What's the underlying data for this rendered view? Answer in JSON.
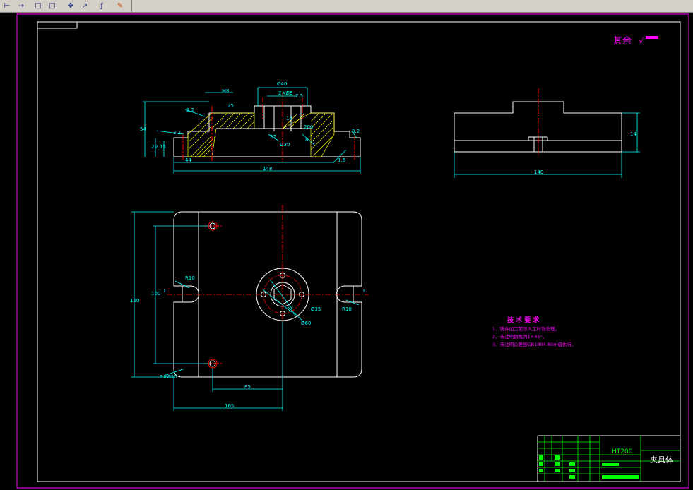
{
  "toolbar": {
    "buttons": [
      {
        "name": "dimension-linear-icon",
        "glyph": "⊢"
      },
      {
        "name": "dimension-continue-icon",
        "glyph": "⇢"
      },
      {
        "name": "rectangle-icon",
        "glyph": "□"
      },
      {
        "name": "square-icon",
        "glyph": "□"
      },
      {
        "name": "move-cross-icon",
        "glyph": "✥"
      },
      {
        "name": "leader-icon",
        "glyph": "↗"
      },
      {
        "name": "tolerance-icon",
        "glyph": "ƒ"
      },
      {
        "name": "eraser-icon",
        "glyph": "✎"
      }
    ]
  },
  "drawing": {
    "roughness_label": "其余",
    "roughness_symbol": "√",
    "front_view_dims": [
      "Ø40",
      "M8",
      "2×Ø8",
      "7.5",
      "25",
      "54",
      "27",
      "Ø30",
      "20",
      "15",
      "3.2",
      "14",
      "8",
      "1.6",
      "3.2",
      "3.2",
      "200",
      "148",
      "44"
    ],
    "side_view_dims": [
      "14",
      "140"
    ],
    "top_view_dims": [
      "150",
      "100",
      "R10",
      "R10",
      "2×Ø10",
      "Ø35",
      "Ø60",
      "85",
      "165",
      "C",
      "C"
    ],
    "tech_req_title": "技 术 要 求",
    "tech_req_items": [
      "1、铸件加工前须人工时效处理。",
      "2、未注明倒角为1×45°。",
      "3、未注明公差按GB1804-80m级执行。"
    ],
    "title_block": {
      "material": "HT200",
      "part_name": "夹具体"
    }
  },
  "colors": {
    "background": "#000000",
    "outline": "#ffffff",
    "dimension": "#00ffff",
    "centerline": "#ff0000",
    "hatch": "#ffff00",
    "text_magenta": "#ff00ff",
    "border_magenta": "#ff00ff",
    "title_block_green": "#00ff00"
  }
}
